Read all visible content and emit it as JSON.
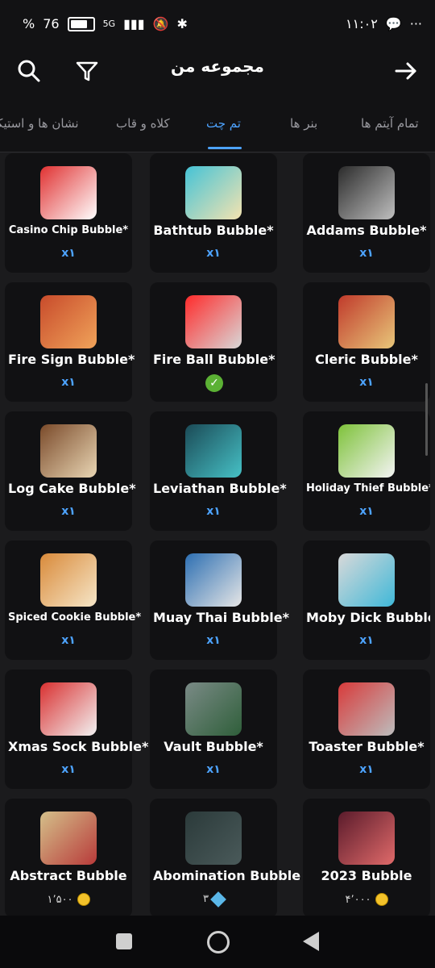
{
  "status": {
    "battery": "76",
    "battery_prefix": "%",
    "network": "5G",
    "time": "۱۱:۰۲"
  },
  "header": {
    "title": "مجموعه من"
  },
  "tabs": [
    {
      "label": "تمام آیتم ها"
    },
    {
      "label": "بنر ها"
    },
    {
      "label": "تم چت",
      "active": true
    },
    {
      "label": "کلاه و قاب"
    },
    {
      "label": "نشان ها و استیکر"
    }
  ],
  "items": [
    {
      "name": "Casino Chip Bubble*",
      "count": "x۱",
      "size": "small",
      "colors": [
        "#e03131",
        "#ffffff"
      ]
    },
    {
      "name": "Bathtub Bubble*",
      "count": "x۱",
      "colors": [
        "#45c3d6",
        "#f4e3b0"
      ]
    },
    {
      "name": "Addams Bubble*",
      "count": "x۱",
      "colors": [
        "#2b2b2b",
        "#bfbfbf"
      ]
    },
    {
      "name": "Fire Sign Bubble*",
      "count": "x۱",
      "colors": [
        "#c84b2b",
        "#f0a35a"
      ]
    },
    {
      "name": "Fire Ball Bubble*",
      "owned": true,
      "colors": [
        "#ff2b2b",
        "#d8d8d8"
      ]
    },
    {
      "name": "Cleric Bubble*",
      "count": "x۱",
      "colors": [
        "#c03a2b",
        "#e8c77a"
      ]
    },
    {
      "name": "Log Cake Bubble*",
      "count": "x۱",
      "colors": [
        "#7a4a2a",
        "#e9d6b4"
      ]
    },
    {
      "name": "Leviathan Bubble*",
      "count": "x۱",
      "colors": [
        "#1b4a56",
        "#46c1c6"
      ]
    },
    {
      "name": "Holiday Thief Bubble*",
      "count": "x۱",
      "size": "small",
      "colors": [
        "#7ec23a",
        "#f4f4f4"
      ]
    },
    {
      "name": "Spiced Cookie Bubble*",
      "count": "x۱",
      "size": "small",
      "colors": [
        "#d98a3a",
        "#f6e6c8"
      ]
    },
    {
      "name": "Muay Thai Bubble*",
      "count": "x۱",
      "colors": [
        "#2d6fb2",
        "#e6e6e6"
      ]
    },
    {
      "name": "Moby Dick Bubble*",
      "count": "x۱",
      "colors": [
        "#d9d9d9",
        "#3fb8d8"
      ]
    },
    {
      "name": "Xmas Sock Bubble*",
      "count": "x۱",
      "colors": [
        "#d93030",
        "#f2f2f2"
      ]
    },
    {
      "name": "Vault Bubble*",
      "count": "x۱",
      "colors": [
        "#7a8a86",
        "#2f5f3a"
      ]
    },
    {
      "name": "Toaster Bubble*",
      "count": "x۱",
      "colors": [
        "#d83a3a",
        "#bdbdbd"
      ]
    },
    {
      "name": "Abstract Bubble",
      "price": "۱٬۵۰۰",
      "currency": "coin",
      "colors": [
        "#d4c08a",
        "#b83a3a"
      ]
    },
    {
      "name": "Abomination Bubble",
      "price": "۳",
      "currency": "gem",
      "colors": [
        "#2b3a3a",
        "#4a5a5a"
      ]
    },
    {
      "name": "2023 Bubble",
      "price": "۴٬۰۰۰",
      "currency": "coin",
      "colors": [
        "#5a1b2b",
        "#e06a6a"
      ]
    }
  ],
  "navigation": {
    "square": "recent-apps",
    "circle": "home",
    "triangle": "back"
  }
}
